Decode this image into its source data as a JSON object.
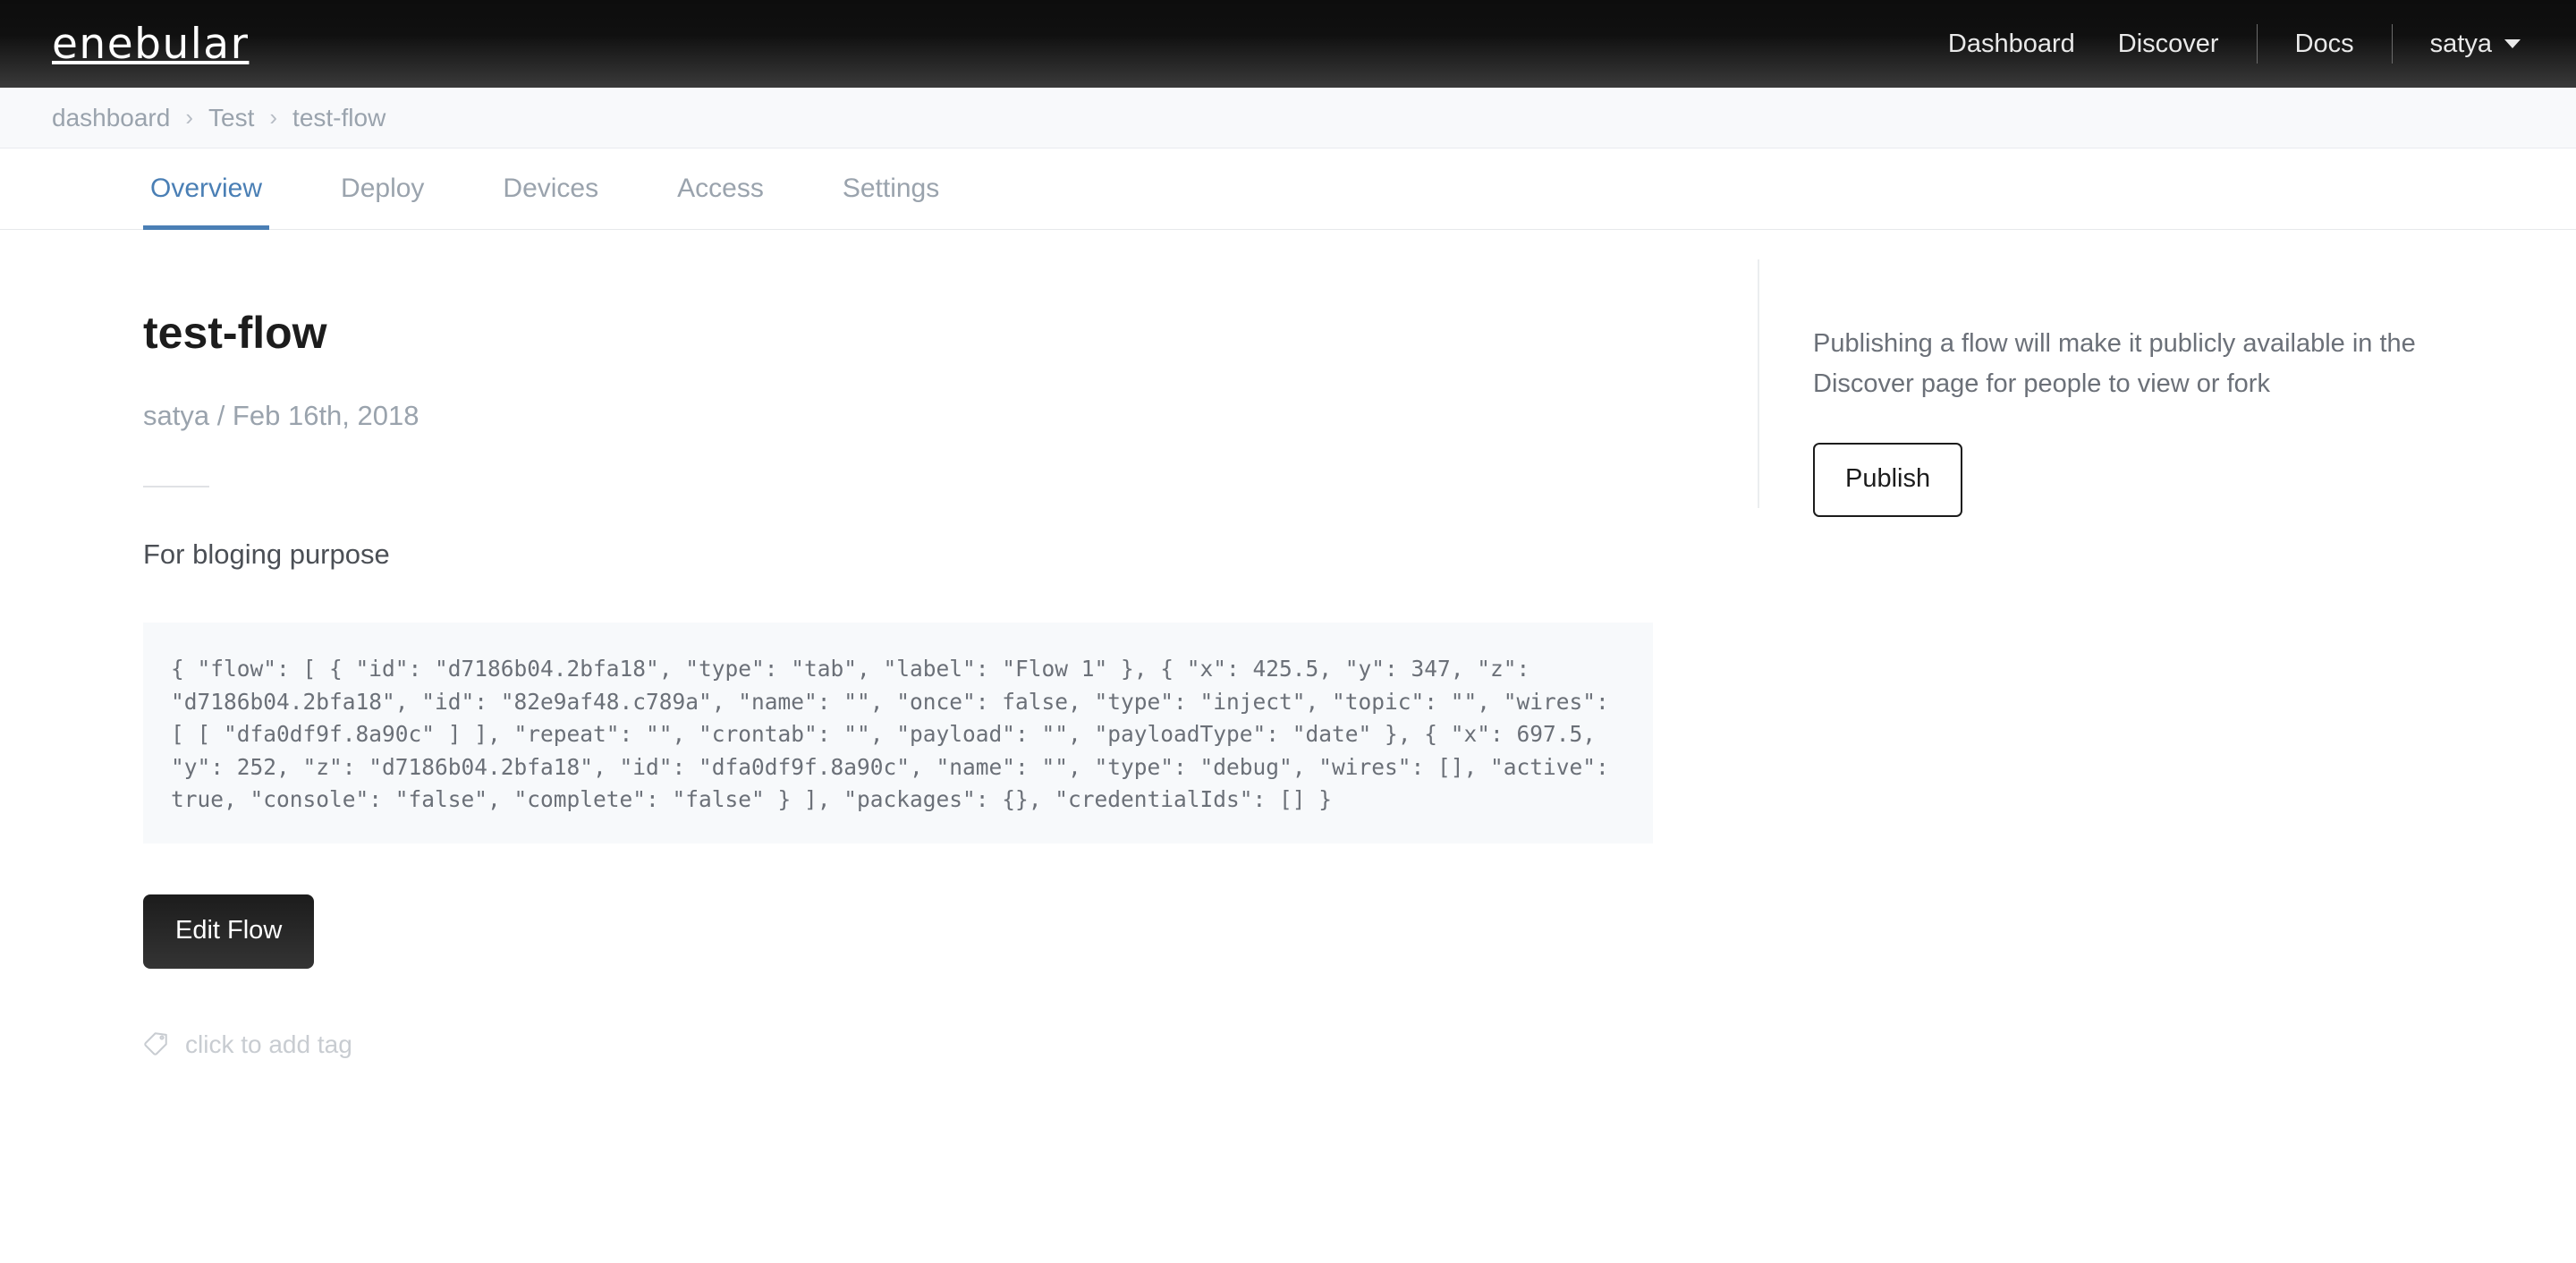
{
  "header": {
    "logo": "enebular",
    "nav": [
      {
        "label": "Dashboard",
        "name": "nav-dashboard"
      },
      {
        "label": "Discover",
        "name": "nav-discover"
      },
      {
        "label": "Docs",
        "name": "nav-docs"
      }
    ],
    "user": "satya"
  },
  "breadcrumb": {
    "items": [
      "dashboard",
      "Test",
      "test-flow"
    ],
    "separator": "›"
  },
  "tabs": [
    {
      "label": "Overview",
      "active": true
    },
    {
      "label": "Deploy",
      "active": false
    },
    {
      "label": "Devices",
      "active": false
    },
    {
      "label": "Access",
      "active": false
    },
    {
      "label": "Settings",
      "active": false
    }
  ],
  "main": {
    "title": "test-flow",
    "meta": "satya / Feb 16th, 2018",
    "description": "For bloging purpose",
    "code": "{ \"flow\": [ { \"id\": \"d7186b04.2bfa18\", \"type\": \"tab\", \"label\": \"Flow 1\" }, { \"x\": 425.5, \"y\": 347, \"z\": \"d7186b04.2bfa18\", \"id\": \"82e9af48.c789a\", \"name\": \"\", \"once\": false, \"type\": \"inject\", \"topic\": \"\", \"wires\": [ [ \"dfa0df9f.8a90c\" ] ], \"repeat\": \"\", \"crontab\": \"\", \"payload\": \"\", \"payloadType\": \"date\" }, { \"x\": 697.5, \"y\": 252, \"z\": \"d7186b04.2bfa18\", \"id\": \"dfa0df9f.8a90c\", \"name\": \"\", \"type\": \"debug\", \"wires\": [], \"active\": true, \"console\": \"false\", \"complete\": \"false\" } ], \"packages\": {}, \"credentialIds\": [] }",
    "edit_button": "Edit Flow",
    "tag_placeholder": "click to add tag",
    "tag_icon": "tag-icon"
  },
  "sidebar": {
    "publish_note": "Publishing a flow will make it publicly available in the Discover page for people to view or fork",
    "publish_button": "Publish"
  },
  "colors": {
    "accent": "#4a7fb5",
    "header_bg": "#101010",
    "muted": "#9aa3ad",
    "code_bg": "#f7f9fb"
  }
}
